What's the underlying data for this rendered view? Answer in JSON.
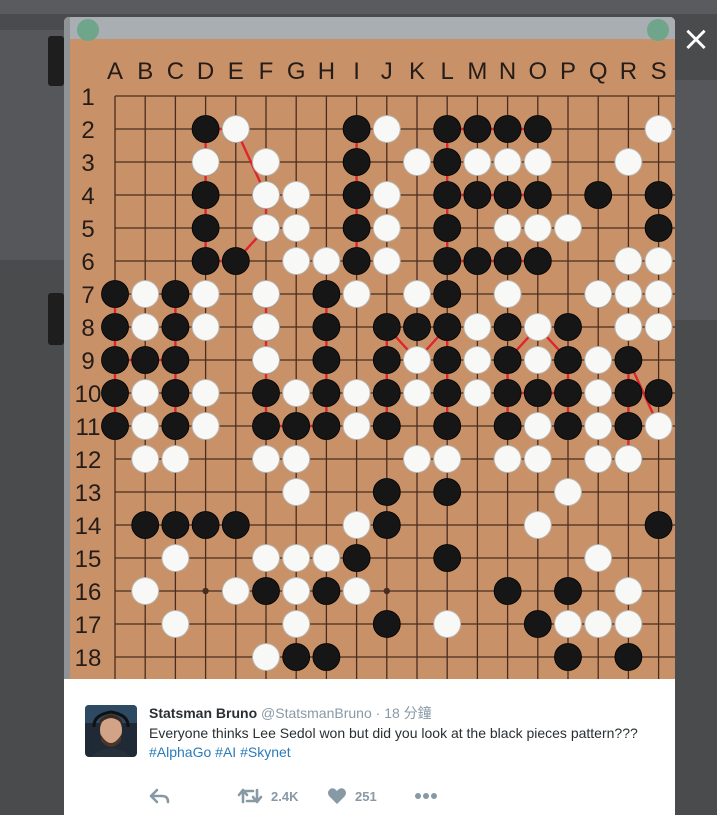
{
  "close_glyph": "×",
  "board": {
    "columns": [
      "A",
      "B",
      "C",
      "D",
      "E",
      "F",
      "G",
      "H",
      "I",
      "J",
      "K",
      "L",
      "M",
      "N",
      "O",
      "P",
      "Q",
      "R",
      "S"
    ],
    "rows": [
      "1",
      "2",
      "3",
      "4",
      "5",
      "6",
      "7",
      "8",
      "9",
      "10",
      "11",
      "12",
      "13",
      "14",
      "15",
      "16",
      "17",
      "18"
    ],
    "colors": {
      "wood": "#c99168",
      "line": "#4a2c1e",
      "stroke": "#e0242d"
    }
  },
  "tweet": {
    "name": "Statsman Bruno",
    "handle": "@StatsmanBruno",
    "separator": " · ",
    "time": "18 分鐘",
    "text": "Everyone thinks Lee Sedol won but did you look at the black pieces pattern??? ",
    "hashtags": [
      "#AlphaGo",
      "#AI",
      "#Skynet"
    ],
    "retweet_count": "2.4K",
    "like_count": "251",
    "icons": [
      "reply-icon",
      "retweet-icon",
      "heart-icon",
      "more-icon"
    ]
  },
  "colors": {
    "link": "#2b7bb9",
    "meta": "#8899a6",
    "text": "#292f33"
  }
}
